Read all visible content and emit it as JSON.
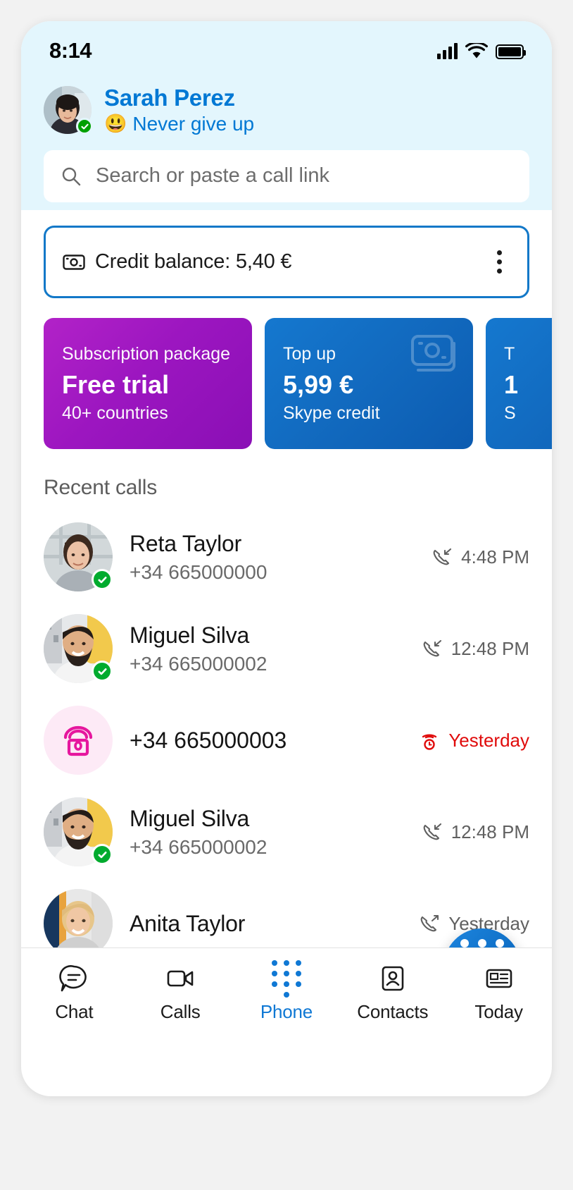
{
  "status_bar": {
    "time": "8:14",
    "signal_icon": "cellular-signal-icon",
    "wifi_icon": "wifi-icon",
    "battery_icon": "battery-full-icon"
  },
  "profile": {
    "name": "Sarah Perez",
    "mood_emoji": "😃",
    "mood": "Never give up",
    "presence": "online"
  },
  "search": {
    "placeholder": "Search or paste a call link",
    "value": "",
    "icon": "search-icon"
  },
  "credit": {
    "icon": "money-icon",
    "label": "Credit balance: 5,40 €",
    "menu_icon": "more-vertical-icon"
  },
  "promo_cards": [
    {
      "kicker": "Subscription package",
      "main": "Free trial",
      "sub": "40+ countries",
      "color": "#9c16c0",
      "icon": ""
    },
    {
      "kicker": "Top up",
      "main": "5,99 €",
      "sub": "Skype credit",
      "color": "#1168bd",
      "icon": "money-icon"
    },
    {
      "kicker": "T",
      "main": "1",
      "sub": "S",
      "color": "#1474cc",
      "icon": ""
    }
  ],
  "recent_calls": {
    "title": "Recent calls",
    "items": [
      {
        "name": "Reta Taylor",
        "number": "+34 665000000",
        "time": "4:48 PM",
        "direction": "incoming",
        "direction_icon": "call-incoming-icon",
        "avatar": "photo-woman-1",
        "presence": "online",
        "missed": false
      },
      {
        "name": "Miguel Silva",
        "number": "+34 665000002",
        "time": "12:48 PM",
        "direction": "incoming",
        "direction_icon": "call-incoming-icon",
        "avatar": "photo-man-1",
        "presence": "online",
        "missed": false
      },
      {
        "name": "",
        "number": "+34 665000003",
        "time": "Yesterday",
        "direction": "missed",
        "direction_icon": "call-missed-icon",
        "avatar": "landline-phone-icon",
        "presence": "none",
        "missed": true
      },
      {
        "name": "Miguel Silva",
        "number": "+34 665000002",
        "time": "12:48 PM",
        "direction": "incoming",
        "direction_icon": "call-incoming-icon",
        "avatar": "photo-man-1",
        "presence": "online",
        "missed": false
      },
      {
        "name": "Anita Taylor",
        "number": "",
        "time": "Yesterday",
        "direction": "outgoing",
        "direction_icon": "call-outgoing-icon",
        "avatar": "photo-woman-2",
        "presence": "none",
        "missed": false
      }
    ]
  },
  "dial_fab": {
    "icon": "dialpad-icon"
  },
  "nav": {
    "items": [
      {
        "label": "Chat",
        "icon": "chat-bubble-icon",
        "active": false
      },
      {
        "label": "Calls",
        "icon": "video-camera-icon",
        "active": false
      },
      {
        "label": "Phone",
        "icon": "dialpad-icon",
        "active": true
      },
      {
        "label": "Contacts",
        "icon": "contact-card-icon",
        "active": false
      },
      {
        "label": "Today",
        "icon": "news-icon",
        "active": false
      }
    ]
  },
  "colors": {
    "accent": "#0078d4",
    "header_bg": "#e3f6fd",
    "missed_red": "#e00b0b",
    "presence_green": "#00ab2e",
    "landline_pink": "#e6179e"
  }
}
